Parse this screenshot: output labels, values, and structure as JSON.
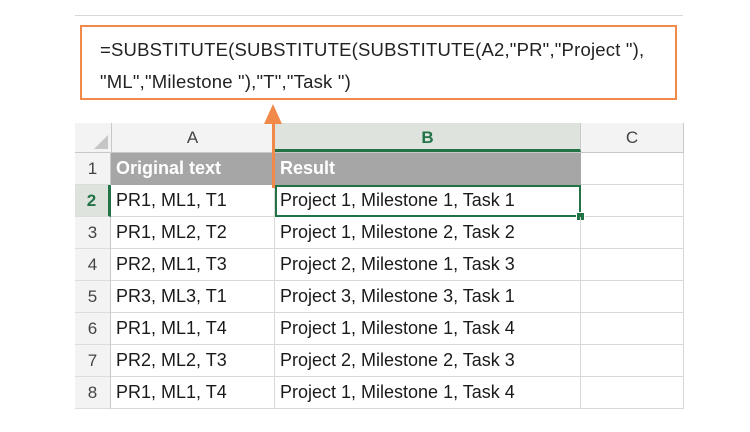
{
  "formula": {
    "line1": "=SUBSTITUTE(SUBSTITUTE(SUBSTITUTE(A2,\"PR\",\"Project \"),",
    "line2": "\"ML\",\"Milestone \"),\"T\",\"Task \")"
  },
  "columns": [
    "A",
    "B",
    "C"
  ],
  "rows": [
    {
      "num": "1",
      "a": "Original text",
      "b": "Result",
      "header": true
    },
    {
      "num": "2",
      "a": "PR1, ML1, T1",
      "b": "Project 1, Milestone 1, Task 1"
    },
    {
      "num": "3",
      "a": "PR1, ML2, T2",
      "b": "Project 1, Milestone 2, Task 2"
    },
    {
      "num": "4",
      "a": "PR2, ML1, T3",
      "b": "Project 2, Milestone 1, Task 3"
    },
    {
      "num": "5",
      "a": "PR3, ML3, T1",
      "b": "Project 3, Milestone 3, Task 1"
    },
    {
      "num": "6",
      "a": "PR1, ML1, T4",
      "b": "Project 1, Milestone 1, Task 4"
    },
    {
      "num": "7",
      "a": "PR2, ML2, T3",
      "b": "Project 2, Milestone 2, Task 3"
    },
    {
      "num": "8",
      "a": "PR1, ML1, T4",
      "b": "Project 1, Milestone 1, Task 4"
    }
  ],
  "selection": {
    "row": "2",
    "column": "B"
  },
  "colors": {
    "accent_arrow": "#f0894a",
    "selection_green": "#217346",
    "header_fill": "#a6a6a6"
  }
}
